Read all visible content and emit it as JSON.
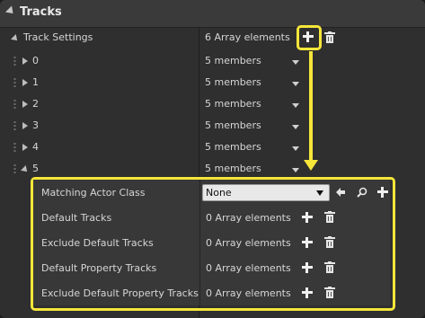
{
  "section": {
    "title": "Tracks"
  },
  "track_settings": {
    "label": "Track Settings",
    "value": "6 Array elements"
  },
  "elements": [
    {
      "label": "0",
      "value": "5 members"
    },
    {
      "label": "1",
      "value": "5 members"
    },
    {
      "label": "2",
      "value": "5 members"
    },
    {
      "label": "3",
      "value": "5 members"
    },
    {
      "label": "4",
      "value": "5 members"
    },
    {
      "label": "5",
      "value": "5 members"
    }
  ],
  "element5": {
    "matching_actor_class": {
      "label": "Matching Actor Class",
      "value": "None"
    },
    "default_tracks": {
      "label": "Default Tracks",
      "value": "0 Array elements"
    },
    "exclude_default_tracks": {
      "label": "Exclude Default Tracks",
      "value": "0 Array elements"
    },
    "default_property_tracks": {
      "label": "Default Property Tracks",
      "value": "0 Array elements"
    },
    "exclude_default_property_tracks": {
      "label": "Exclude Default Property Tracks",
      "value": "0 Array elements"
    }
  },
  "colors": {
    "highlight": "#f5e63a",
    "panel": "#2f2f2f",
    "header": "#3a3a3a"
  },
  "icons": [
    "collapse-arrow-icon",
    "plus-icon",
    "trash-icon",
    "expand-triangle-icon",
    "chevron-down-icon",
    "arrow-left-icon",
    "search-icon"
  ]
}
